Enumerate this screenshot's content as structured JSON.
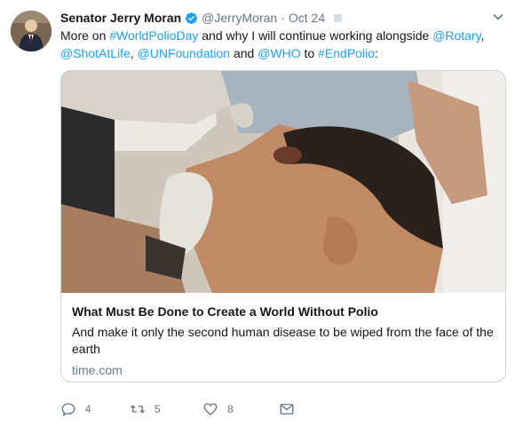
{
  "tweet": {
    "author_name": "Senator Jerry Moran",
    "handle": "@JerryMoran",
    "separator": "·",
    "date": "Oct 24",
    "text_parts": [
      {
        "text": "More on ",
        "link": false
      },
      {
        "text": "#WorldPolioDay",
        "link": true
      },
      {
        "text": " and why I will continue working alongside ",
        "link": false
      },
      {
        "text": "@Rotary",
        "link": true
      },
      {
        "text": ", ",
        "link": false
      },
      {
        "text": "@ShotAtLife",
        "link": true
      },
      {
        "text": ", ",
        "link": false
      },
      {
        "text": "@UNFoundation",
        "link": true
      },
      {
        "text": " and ",
        "link": false
      },
      {
        "text": "@WHO",
        "link": true
      },
      {
        "text": " to ",
        "link": false
      },
      {
        "text": "#EndPolio",
        "link": true
      },
      {
        "text": ":",
        "link": false
      }
    ]
  },
  "card": {
    "title": "What Must Be Done to Create a World Without Polio",
    "description": "And make it only the second human disease to be wiped from the face of the earth",
    "domain": "time.com"
  },
  "actions": {
    "reply_count": "4",
    "retweet_count": "5",
    "like_count": "8"
  },
  "icons": {
    "verified": "verified-badge-icon",
    "caret": "chevron-down-icon",
    "reply": "reply-icon",
    "retweet": "retweet-icon",
    "like": "heart-icon",
    "dm": "envelope-icon"
  },
  "colors": {
    "link": "#1da1f2",
    "muted": "#657786",
    "border": "#ccd6dd"
  }
}
